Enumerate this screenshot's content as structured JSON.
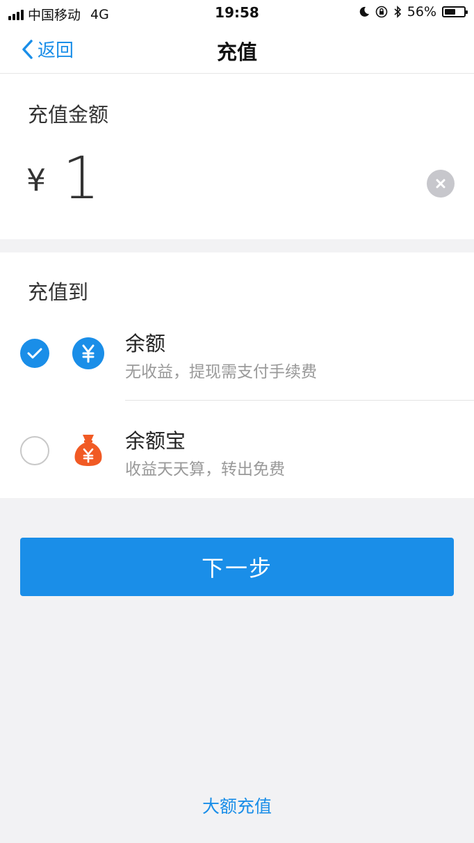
{
  "status_bar": {
    "carrier": "中国移动",
    "network": "4G",
    "time": "19:58",
    "battery": "56%",
    "battery_level": 0.56
  },
  "nav": {
    "back_label": "返回",
    "title": "充值"
  },
  "amount_section": {
    "label": "充值金额",
    "currency_symbol": "¥",
    "amount_value": "1"
  },
  "target_section": {
    "label": "充值到",
    "options": [
      {
        "title": "余额",
        "desc": "无收益，提现需支付手续费",
        "selected": true,
        "icon": "yuan-circle-icon",
        "icon_color": "#1a8ee8"
      },
      {
        "title": "余额宝",
        "desc": "收益天天算，转出免费",
        "selected": false,
        "icon": "money-bag-icon",
        "icon_color": "#f15a24"
      }
    ]
  },
  "actions": {
    "next_label": "下一步",
    "big_recharge_label": "大额充值"
  },
  "colors": {
    "accent": "#1a8ee8",
    "background": "#f2f2f4",
    "bag_orange": "#f15a24"
  }
}
